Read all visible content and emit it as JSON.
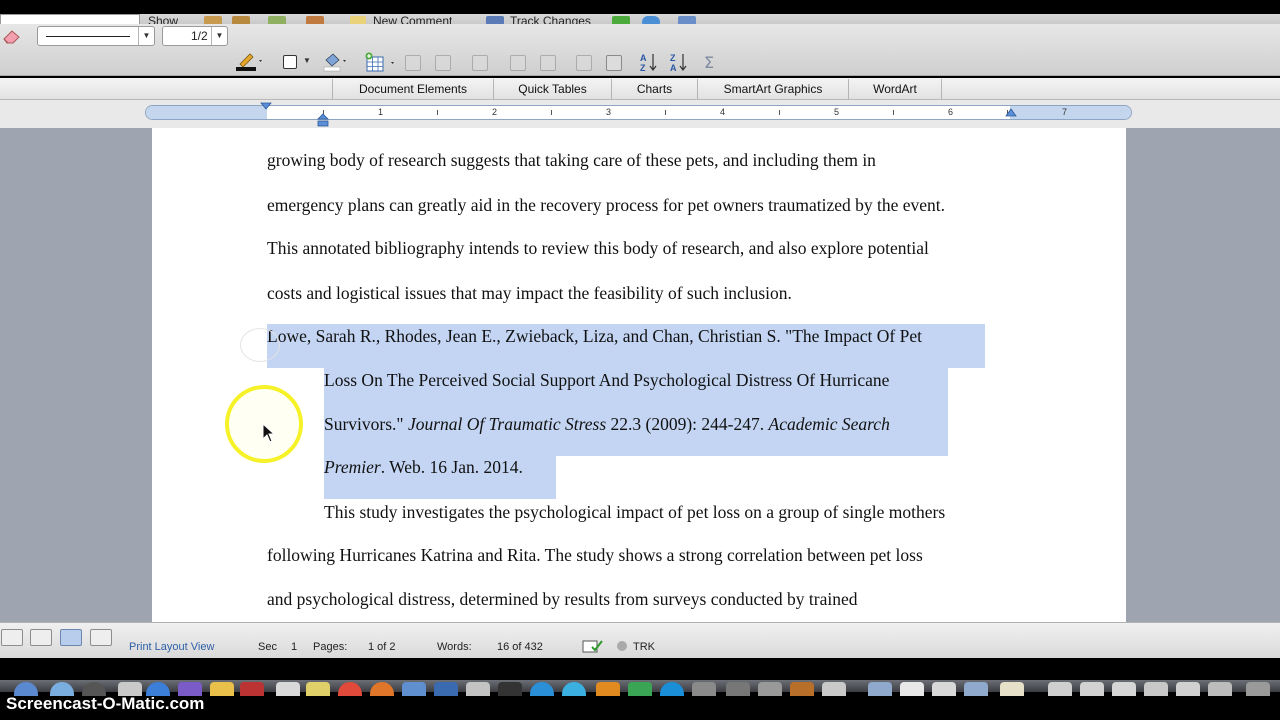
{
  "toolbar_top": {
    "show_label": "Show",
    "new_comment_label": "New Comment",
    "track_changes_label": "Track Changes"
  },
  "toolbar_format": {
    "line_weight_value": "1/2"
  },
  "ribbon": {
    "tabs": [
      "Document Elements",
      "Quick Tables",
      "Charts",
      "SmartArt Graphics",
      "WordArt"
    ]
  },
  "ruler": {
    "numbers": [
      "1",
      "2",
      "3",
      "4",
      "5",
      "6",
      "7"
    ]
  },
  "document": {
    "lines": [
      "growing body of research suggests that taking care of these pets, and including them in",
      "emergency plans can greatly aid in the recovery process for pet owners traumatized by the event.",
      "This annotated bibliography intends to review this body of research, and also explore potential",
      "costs and logistical issues that may impact the feasibility of such inclusion."
    ],
    "citation": {
      "line1": "Lowe, Sarah R., Rhodes, Jean E., Zwieback, Liza, and Chan, Christian S. \"The Impact Of Pet",
      "line2": "Loss On The Perceived Social Support And Psychological Distress Of Hurricane",
      "line3_a": "Survivors.\" ",
      "line3_journal": "Journal Of Traumatic Stress",
      "line3_b": " 22.3 (2009): 244-247. ",
      "line3_db": "Academic Search",
      "line4_db": "Premier",
      "line4_b": ". Web. 16 Jan. 2014."
    },
    "annotation": [
      "This study investigates the psychological impact of pet loss on a group of single mothers",
      "following Hurricanes Katrina and Rita. The study shows a strong correlation between pet loss",
      "and psychological distress, determined by results from surveys conducted by trained"
    ]
  },
  "status_bar": {
    "view_name": "Print Layout View",
    "sec_label": "Sec",
    "sec_value": "1",
    "pages_label": "Pages:",
    "pages_value": "1 of 2",
    "words_label": "Words:",
    "words_value": "16 of 432",
    "trk_label": "TRK"
  },
  "watermark": "Screencast-O-Matic.com",
  "colors": {
    "selection": "#c3d5f3",
    "cursor_highlight": "#f6f227",
    "status_blue": "#2e5fa7"
  }
}
